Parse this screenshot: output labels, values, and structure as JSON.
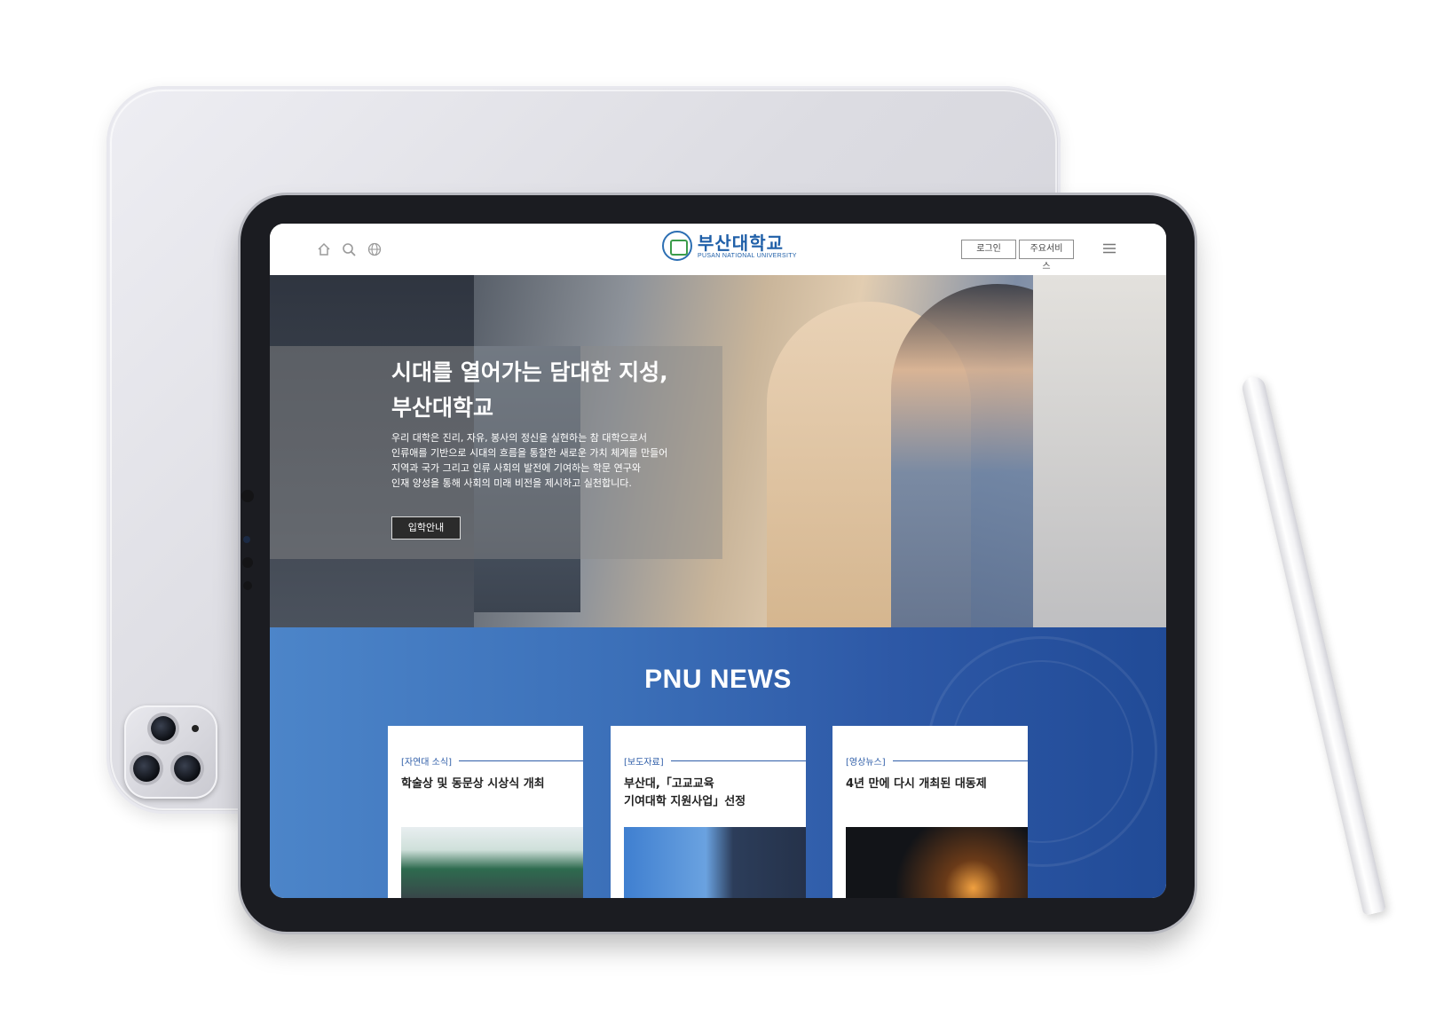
{
  "header": {
    "logo_korean": "부산대학교",
    "logo_english": "PUSAN NATIONAL UNIVERSITY",
    "login_label": "로그인",
    "services_label": "주요서비스",
    "icons": [
      "home-icon",
      "search-icon",
      "globe-icon",
      "menu-icon"
    ]
  },
  "hero": {
    "title_line1": "시대를 열어가는 담대한 지성,",
    "title_line2": "부산대학교",
    "description": [
      "우리 대학은 진리, 자유, 봉사의 정신을 실현하는 참 대학으로서",
      "인류애를 기반으로 시대의 흐름을 통찰한 새로운 가치 체계를 만들어",
      "지역과 국가 그리고 인류 사회의 발전에 기여하는 학문 연구와",
      "인재 양성을 통해 사회의 미래 비전을 제시하고 실천합니다."
    ],
    "button_label": "입학안내"
  },
  "news": {
    "title": "PNU NEWS",
    "cards": [
      {
        "category": "[자연대 소식]",
        "title_lines": [
          "학술상 및 동문상 시상식 개최"
        ]
      },
      {
        "category": "[보도자료]",
        "title_lines": [
          "부산대,「고교교육",
          "기여대학 지원사업」선정"
        ]
      },
      {
        "category": "[영상뉴스]",
        "title_lines": [
          "4년 만에 다시 개최된 대동제"
        ]
      }
    ]
  },
  "colors": {
    "brand_blue": "#1f5fa8",
    "news_bg_start": "#4c85c9",
    "news_bg_end": "#214b97",
    "hero_button_bg": "#2b2b2b"
  }
}
